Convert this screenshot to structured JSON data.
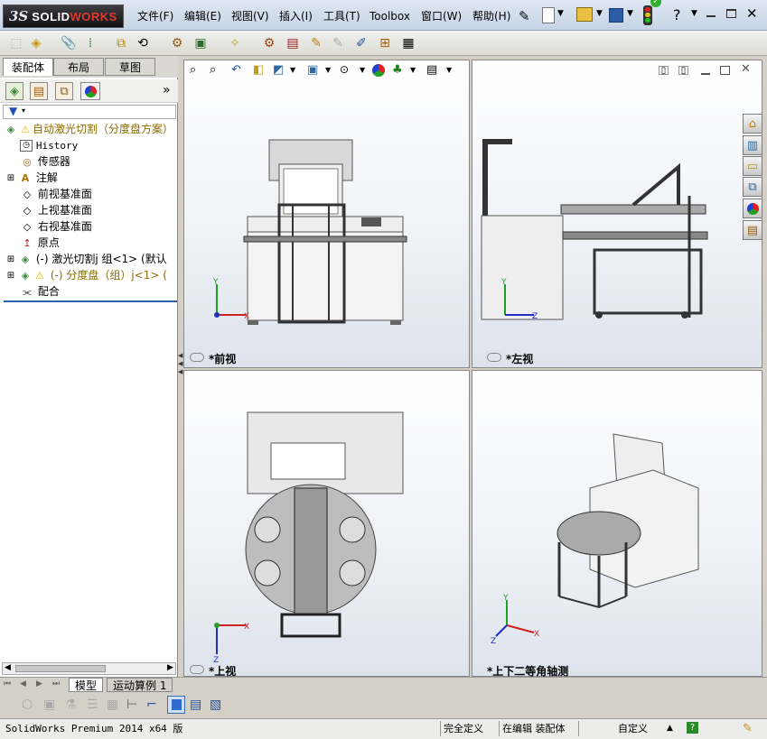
{
  "app": {
    "logo_ds": "3S",
    "logo_solid": "SOLID",
    "logo_works": "WORKS",
    "menus": [
      "文件(F)",
      "编辑(E)",
      "视图(V)",
      "插入(I)",
      "工具(T)",
      "Toolbox",
      "窗口(W)",
      "帮助(H)"
    ],
    "help_label": "?"
  },
  "left_panel": {
    "tabs": [
      "装配体",
      "布局",
      "草图"
    ],
    "active_tab": "装配体",
    "tree": [
      {
        "label": "自动激光切割（分度盘方案）",
        "icon": "assembly-warning-icon",
        "color": "#8a6d00"
      },
      {
        "label": "History",
        "icon": "history-icon",
        "color": "#000000"
      },
      {
        "label": "传感器",
        "icon": "sensor-icon",
        "color": "#000000"
      },
      {
        "label": "注解",
        "icon": "annotation-icon",
        "color": "#000000"
      },
      {
        "label": "前视基准面",
        "icon": "plane-icon",
        "color": "#000000"
      },
      {
        "label": "上视基准面",
        "icon": "plane-icon",
        "color": "#000000"
      },
      {
        "label": "右视基准面",
        "icon": "plane-icon",
        "color": "#000000"
      },
      {
        "label": "原点",
        "icon": "origin-icon",
        "color": "#000000"
      },
      {
        "label": "(-) 激光切割j 组<1> (默认",
        "icon": "subassembly-icon",
        "color": "#000000"
      },
      {
        "label": "(-) 分度盘（组）j<1> (",
        "icon": "subassembly-warning-icon",
        "color": "#8a6d00"
      },
      {
        "label": "配合",
        "icon": "mates-icon",
        "color": "#000000"
      }
    ]
  },
  "viewports": [
    {
      "label": "*前视"
    },
    {
      "label": "*左视"
    },
    {
      "label": "*上视"
    },
    {
      "label": "*上下二等角轴测"
    }
  ],
  "bottom_tabs": [
    "模型",
    "运动算例 1"
  ],
  "status": {
    "version": "SolidWorks Premium 2014 x64 版",
    "definition": "完全定义",
    "editing": "在编辑 装配体",
    "custom": "自定义"
  },
  "colors": {
    "warning": "#e8b000",
    "tree_warning_text": "#8a6d00",
    "viewport_bg_top": "#ffffff",
    "viewport_bg_bottom": "#dde3ec",
    "axis_x": "#d02020",
    "axis_y": "#20a020",
    "axis_z": "#2030c0"
  }
}
